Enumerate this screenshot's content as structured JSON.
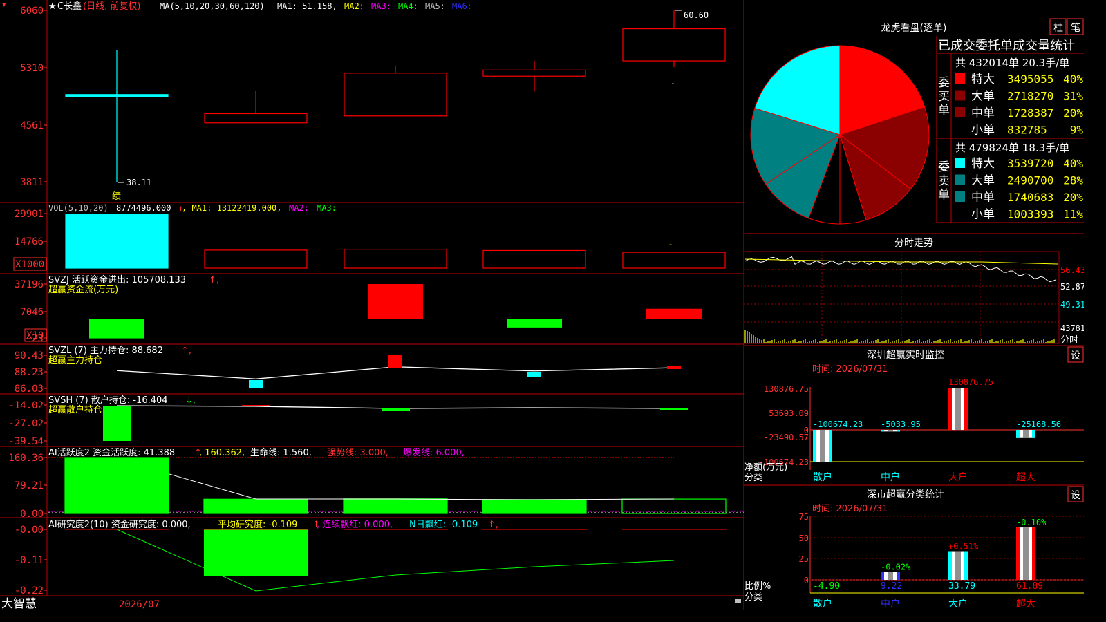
{
  "colors": {
    "red": "#ff0000",
    "cyan": "#00ffff",
    "green": "#00ff00",
    "yellow": "#ffff00",
    "magenta": "#ff00ff",
    "white": "#ffffff",
    "darkred": "#8b0000",
    "teal": "#008080",
    "blue": "#3030ff",
    "axis_red": "#ff3030",
    "grid_red": "#a00000"
  },
  "app": {
    "brand": "大智慧",
    "date_label": "2026/07",
    "star_marker": "★"
  },
  "main": {
    "stock": "C长鑫",
    "mode": "(日线, 前复权)",
    "ma_label": "MA(5,10,20,30,60,120)",
    "ma1": "MA1: 51.158,",
    "ma2": "MA2:",
    "ma3": "MA3:",
    "ma4": "MA4:",
    "ma5": "MA5:",
    "ma6": "MA6:",
    "yticks": [
      "6060",
      "5310",
      "4561",
      "3811"
    ],
    "high_marker": "60.60",
    "low_marker": "38.11",
    "flag": "绩"
  },
  "vol": {
    "label": "VOL(5,10,20)",
    "value": "8774496.000",
    "ma1": ", MA1: 13122419.000,",
    "ma2": "MA2:",
    "ma3": "MA3:",
    "yticks": [
      "29901",
      "14766"
    ],
    "unit": "X1000"
  },
  "svzj": {
    "label": "SVZJ  活跃资金进出: 105708.133",
    "sub": "超赢资金流(万元)",
    "yticks": [
      "37196",
      "7046",
      "-23"
    ],
    "unit": "X10"
  },
  "svzl": {
    "label": "SVZL (7) 主力持仓: 88.682",
    "sub": "超赢主力持仓",
    "yticks": [
      "90.43",
      "88.23",
      "86.03"
    ]
  },
  "svsh": {
    "label": "SVSH (7) 散户持仓: -16.404",
    "sub": "超赢散户持仓",
    "yticks": [
      "-14.02",
      "-27.02",
      "-39.54"
    ]
  },
  "ai1": {
    "label": "AI活跃度2 资金活跃度: 41.388",
    "v2": ", 160.362,",
    "life": "生命线: 1.560,",
    "strong": "强势线: 3.000,",
    "burst": "爆发线: 6.000,",
    "yticks": [
      "160.36",
      "79.21",
      "0.00"
    ]
  },
  "ai2": {
    "label": "AI研究度2(10) 资金研究度: 0.000,",
    "avg": "平均研究度: -0.109",
    "red1": ", 连续飘红: 0.000,",
    "red2": "N日飘红: -0.109",
    "yticks": [
      "-0.00",
      "-0.11",
      "-0.22"
    ]
  },
  "longhu": {
    "title": "龙虎看盘(逐单)",
    "btn_zhu": "柱",
    "btn_bi": "笔",
    "subtitle": "已成交委托单成交量统计",
    "buy_label": "委买单",
    "sell_label": "委卖单",
    "buy_total": "共 432014单 20.3手/单",
    "sell_total": "共 479824单 18.3手/单",
    "buy_rows": [
      {
        "name": "特大",
        "value": "3495055",
        "pct": "40%"
      },
      {
        "name": "大单",
        "value": "2718270",
        "pct": "31%"
      },
      {
        "name": "中单",
        "value": "1728387",
        "pct": "20%"
      },
      {
        "name": "小单",
        "value": "832785",
        "pct": "9%"
      }
    ],
    "sell_rows": [
      {
        "name": "特大",
        "value": "3539720",
        "pct": "40%"
      },
      {
        "name": "大单",
        "value": "2490700",
        "pct": "28%"
      },
      {
        "name": "中单",
        "value": "1740683",
        "pct": "20%"
      },
      {
        "name": "小单",
        "value": "1003393",
        "pct": "11%"
      }
    ]
  },
  "fenshi": {
    "title": "分时走势",
    "yticks": [
      "56.43",
      "52.87",
      "49.31"
    ],
    "vol_tick": "43781",
    "xlabel": "分时"
  },
  "monitor": {
    "title": "深圳超赢实时监控",
    "btn": "设",
    "time": "时间: 2026/07/31",
    "yticks": [
      "130876.75",
      "53693.09",
      "0",
      "-23490.57",
      "-100674.23"
    ],
    "ylabel1": "净额(万元)",
    "ylabel2": "分类",
    "values": [
      "-100674.23",
      "-5033.95",
      "130876.75",
      "-25168.56"
    ],
    "categories": [
      "散户",
      "中户",
      "大户",
      "超大"
    ]
  },
  "classify": {
    "title": "深市超赢分类统计",
    "btn": "设",
    "time": "时间: 2026/07/31",
    "yticks": [
      "75",
      "50",
      "25",
      "0"
    ],
    "ylabel1": "比例%",
    "ylabel2": "分类",
    "top_labels": [
      "-4.90",
      "-0.02%",
      "+0.51%",
      "-0.10%"
    ],
    "bottom_values": [
      "-4.90",
      "9.22",
      "33.79",
      "61.89"
    ],
    "categories": [
      "散户",
      "中户",
      "大户",
      "超大"
    ]
  },
  "chart_data": [
    {
      "type": "candlestick",
      "name": "C长鑫 日线",
      "ylim": [
        38.11,
        60.6
      ],
      "candles": [
        {
          "open": 49.6,
          "close": 49.3,
          "high": 55.4,
          "low": 38.11
        },
        {
          "open": 45.9,
          "close": 47.1,
          "high": 50.1,
          "low": 45.9
        },
        {
          "open": 46.8,
          "close": 52.4,
          "high": 53.4,
          "low": 46.8
        },
        {
          "open": 52.0,
          "close": 52.8,
          "high": 54.0,
          "low": 50.0
        },
        {
          "open": 54.0,
          "close": 58.2,
          "high": 60.6,
          "low": 53.2
        }
      ]
    },
    {
      "type": "bar",
      "name": "VOL",
      "values": [
        32000,
        10000,
        10500,
        9800,
        8774.496
      ],
      "ylim": [
        0,
        29901
      ]
    },
    {
      "type": "bar",
      "name": "SVZJ",
      "values": [
        -2600,
        null,
        4550,
        -1170,
        1300
      ],
      "ylim": [
        -23,
        37196
      ]
    },
    {
      "type": "line",
      "name": "SVZL",
      "values": [
        88.3,
        87.2,
        88.8,
        88.25,
        88.682
      ]
    },
    {
      "type": "line",
      "name": "SVSH",
      "values": [
        -14.0,
        -14.0,
        -14.5,
        -14.3,
        -16.404
      ]
    },
    {
      "type": "bar",
      "name": "AI活跃度2",
      "values": [
        160.36,
        41.0,
        42.0,
        40.0,
        41.388
      ],
      "ylim": [
        0,
        160.36
      ]
    },
    {
      "type": "pie",
      "name": "龙虎看盘",
      "values": [
        3495055,
        2718270,
        1728387,
        832785,
        1003393,
        1740683,
        2490700,
        3539720
      ]
    }
  ]
}
